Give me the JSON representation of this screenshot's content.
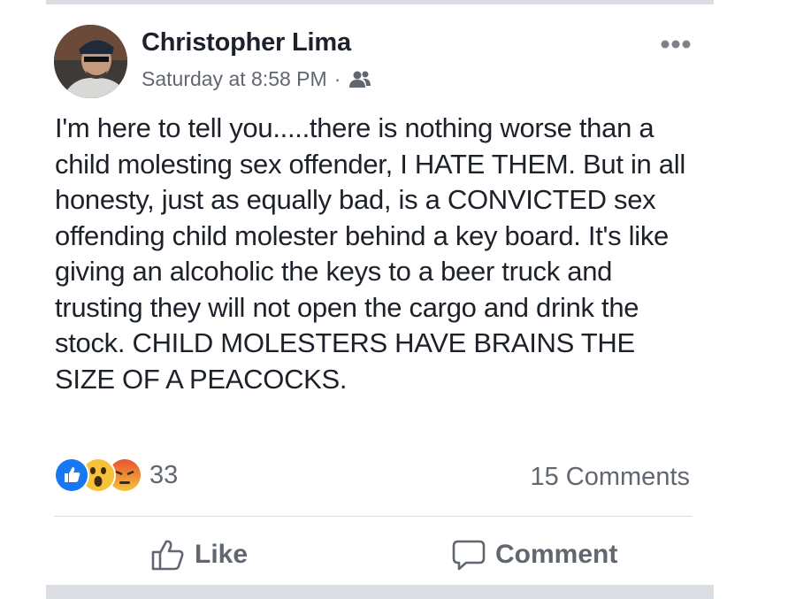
{
  "post": {
    "author": "Christopher Lima",
    "timestamp": "Saturday at 8:58 PM",
    "separator": "·",
    "audience_icon": "friends-icon",
    "more_icon": "more-options-icon",
    "text": "I'm here to tell you.....there is nothing worse than a child molesting sex offender, I HATE THEM. But in all honesty, just as equally bad, is a CONVICTED sex offending child molester behind a key board. It's like giving an alcoholic the keys to a beer truck and trusting they will not open the cargo and drink the stock. CHILD MOLESTERS HAVE BRAINS THE SIZE OF A PEACOCKS."
  },
  "reactions": {
    "types": [
      "like",
      "wow",
      "angry"
    ],
    "count": "33"
  },
  "comments": {
    "count_label": "15 Comments"
  },
  "actions": {
    "like_label": "Like",
    "comment_label": "Comment"
  },
  "colors": {
    "text": "#1d2129",
    "secondary": "#616770",
    "like_blue": "#1877f2",
    "divider": "#dadde1"
  }
}
